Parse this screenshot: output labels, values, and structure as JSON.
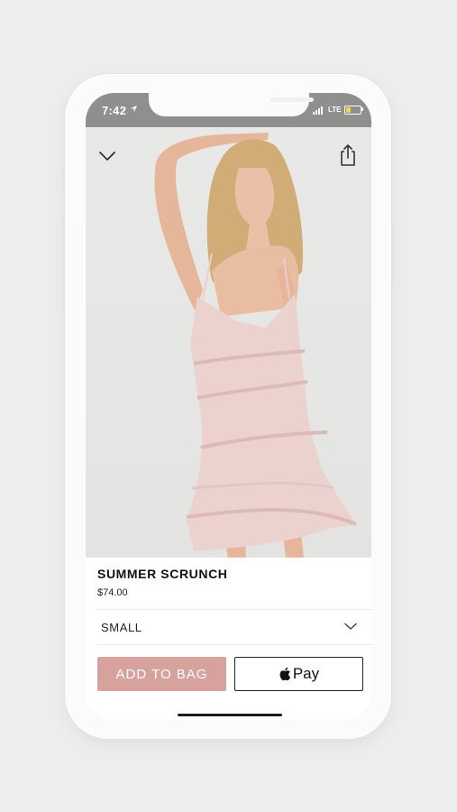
{
  "status_bar": {
    "time": "7:42",
    "network": "LTE",
    "battery_level": 0.35,
    "battery_color": "#f2d34a"
  },
  "photo": {
    "close_icon": "chevron-down-icon",
    "share_icon": "share-icon"
  },
  "product": {
    "name": "SUMMER SCRUNCH",
    "price": "$74.00",
    "selected_size": "SMALL"
  },
  "actions": {
    "add_to_bag": "ADD TO BAG",
    "apple_pay": "Pay",
    "accent_color": "#d7a29e"
  }
}
